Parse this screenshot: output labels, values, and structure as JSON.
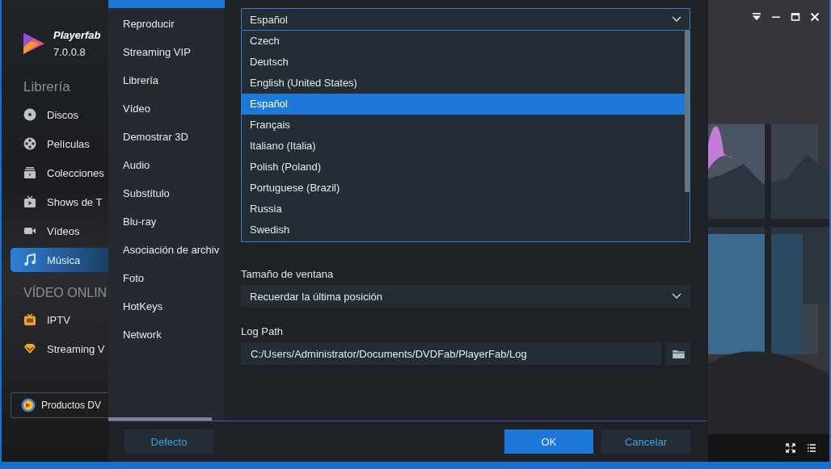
{
  "app": {
    "name": "Playerfab",
    "version": "7.0.0.8"
  },
  "sidebar": {
    "sections": [
      {
        "title": "Librería",
        "items": [
          {
            "label": "Discos",
            "kind": "disc",
            "selected": false
          },
          {
            "label": "Películas",
            "kind": "reel",
            "selected": false
          },
          {
            "label": "Colecciones",
            "kind": "collection",
            "selected": false
          },
          {
            "label": "Shows de T",
            "kind": "tv",
            "selected": false
          },
          {
            "label": "Vídeos",
            "kind": "camera",
            "selected": false
          },
          {
            "label": "Música",
            "kind": "music",
            "selected": true
          }
        ]
      },
      {
        "title": "VÍDEO ONLIN",
        "items": [
          {
            "label": "IPTV",
            "kind": "iptv",
            "selected": false
          },
          {
            "label": "Streaming V",
            "kind": "diamond",
            "selected": false
          }
        ]
      }
    ],
    "products_button": "Productos DV"
  },
  "settings_nav": [
    {
      "label": "Reproducir",
      "selected": false
    },
    {
      "label": "Streaming VIP",
      "selected": false
    },
    {
      "label": "Librería",
      "selected": false
    },
    {
      "label": "Vídeo",
      "selected": false
    },
    {
      "label": "Demostrar 3D",
      "selected": false
    },
    {
      "label": "Audio",
      "selected": false
    },
    {
      "label": "Substítulo",
      "selected": false
    },
    {
      "label": "Blu-ray",
      "selected": false
    },
    {
      "label": "Asociación de archiv",
      "selected": false
    },
    {
      "label": "Foto",
      "selected": false
    },
    {
      "label": "HotKeys",
      "selected": false
    },
    {
      "label": "Network",
      "selected": false
    }
  ],
  "language_select": {
    "value": "Español",
    "expanded": true,
    "options": [
      {
        "label": "Czech",
        "selected": false
      },
      {
        "label": "Deutsch",
        "selected": false
      },
      {
        "label": "English (United States)",
        "selected": false
      },
      {
        "label": "Español",
        "selected": true
      },
      {
        "label": "Français",
        "selected": false
      },
      {
        "label": "Italiano (Italia)",
        "selected": false
      },
      {
        "label": "Polish (Poland)",
        "selected": false
      },
      {
        "label": "Portuguese (Brazil)",
        "selected": false
      },
      {
        "label": "Russia",
        "selected": false
      },
      {
        "label": "Swedish",
        "selected": false
      }
    ]
  },
  "window_size": {
    "label": "Tamaño de ventana",
    "value": "Recuerdar la última posición"
  },
  "log_path": {
    "label": "Log Path",
    "value": "C:/Users/Administrator/Documents/DVDFab/PlayerFab/Log"
  },
  "buttons": [
    {
      "label": "Defecto",
      "kind": "secondary"
    },
    {
      "label": "OK",
      "kind": "primary"
    },
    {
      "label": "Cancelar",
      "kind": "secondary"
    }
  ]
}
